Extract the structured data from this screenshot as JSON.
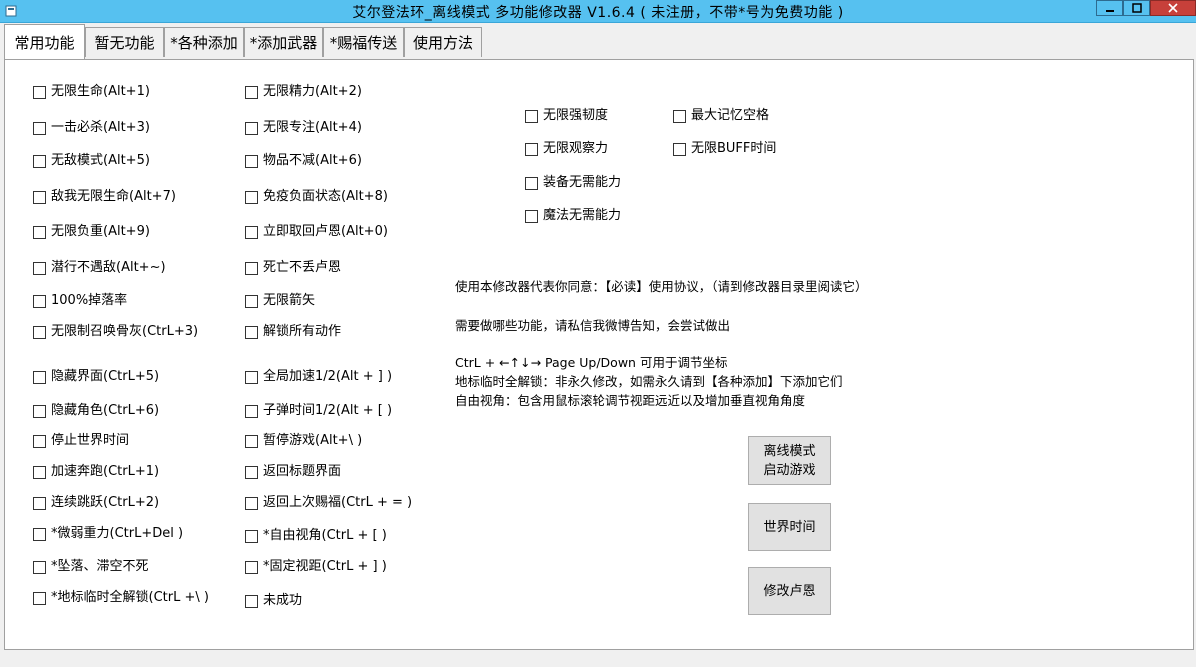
{
  "window": {
    "title": "艾尔登法环_离线模式 多功能修改器 V1.6.4 ( 未注册，不带*号为免费功能 )"
  },
  "tabs": [
    "常用功能",
    "暂无功能",
    "*各种添加",
    "*添加武器",
    "*赐福传送",
    "使用方法"
  ],
  "col1": [
    "无限生命(Alt+1)",
    "一击必杀(Alt+3)",
    "无敌模式(Alt+5)",
    "敌我无限生命(Alt+7)",
    "无限负重(Alt+9)",
    "潜行不遇敌(Alt+~)",
    "100%掉落率",
    "无限制召唤骨灰(CtrL+3)",
    "隐藏界面(CtrL+5)",
    "隐藏角色(CtrL+6)",
    "停止世界时间",
    "加速奔跑(CtrL+1)",
    "连续跳跃(CtrL+2)",
    "*微弱重力(CtrL+Del )",
    "*坠落、滞空不死",
    "*地标临时全解锁(CtrL +\\ )"
  ],
  "col2": [
    "无限精力(Alt+2)",
    "无限专注(Alt+4)",
    "物品不减(Alt+6)",
    "免疫负面状态(Alt+8)",
    "立即取回卢恩(Alt+0)",
    "死亡不丢卢恩",
    "无限箭矢",
    "解锁所有动作",
    "全局加速1/2(Alt + ] )",
    "子弹时间1/2(Alt + [ )",
    "暂停游戏(Alt+\\ )",
    "返回标题界面",
    "返回上次赐福(CtrL + = )",
    "*自由视角(CtrL + [ )",
    "*固定视距(CtrL + ] )",
    "未成功"
  ],
  "col3": [
    "无限强韧度",
    "无限观察力",
    "装备无需能力",
    "魔法无需能力"
  ],
  "col4": [
    "最大记忆空格",
    "无限BUFF时间"
  ],
  "info": {
    "agreement": "使用本修改器代表你同意：【必读】使用协议，（请到修改器目录里阅读它）",
    "request": "需要做哪些功能，请私信我微博告知，会尝试做出",
    "coords": "CtrL + ←↑↓→ Page Up/Down 可用于调节坐标",
    "unlock": "地标临时全解锁：非永久修改，如需永久请到【各种添加】下添加它们",
    "freecam": "自由视角：包含用鼠标滚轮调节视距远近以及增加垂直视角角度"
  },
  "buttons": {
    "offline_line1": "离线模式",
    "offline_line2": "启动游戏",
    "world_time": "世界时间",
    "runes": "修改卢恩"
  },
  "winbtns": {
    "min": "—",
    "max": "☐",
    "close": "✕"
  }
}
